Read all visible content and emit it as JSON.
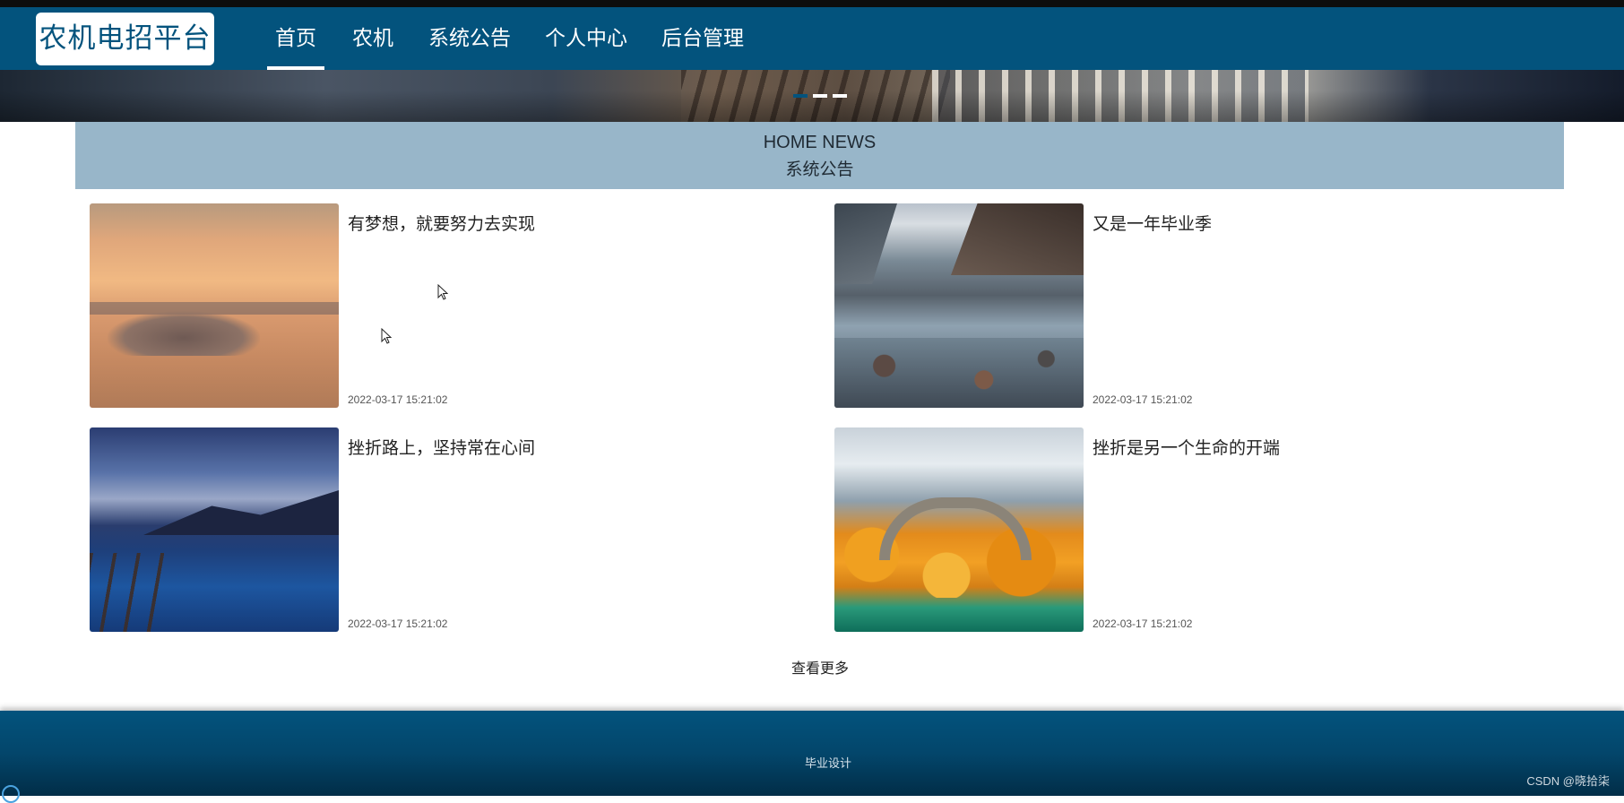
{
  "header": {
    "logo": "农机电招平台",
    "nav": [
      {
        "label": "首页",
        "active": true
      },
      {
        "label": "农机",
        "active": false
      },
      {
        "label": "系统公告",
        "active": false
      },
      {
        "label": "个人中心",
        "active": false
      },
      {
        "label": "后台管理",
        "active": false
      }
    ]
  },
  "banner": {
    "slide_count": 3,
    "active_slide": 1
  },
  "news_section": {
    "title_en": "HOME NEWS",
    "title_cn": "系统公告",
    "items": [
      {
        "title": "有梦想，就要努力去实现",
        "date": "2022-03-17 15:21:02",
        "image": "sunset-clouds"
      },
      {
        "title": "又是一年毕业季",
        "date": "2022-03-17 15:21:02",
        "image": "mountain-river"
      },
      {
        "title": "挫折路上，坚持常在心间",
        "date": "2022-03-17 15:21:02",
        "image": "blue-lake"
      },
      {
        "title": "挫折是另一个生命的开端",
        "date": "2022-03-17 15:21:02",
        "image": "autumn-bridge"
      }
    ],
    "more_label": "查看更多"
  },
  "footer": {
    "text": "毕业设计",
    "watermark": "CSDN @晓拾柒"
  },
  "colors": {
    "primary": "#03537d",
    "section_head": "#98b6c9"
  }
}
